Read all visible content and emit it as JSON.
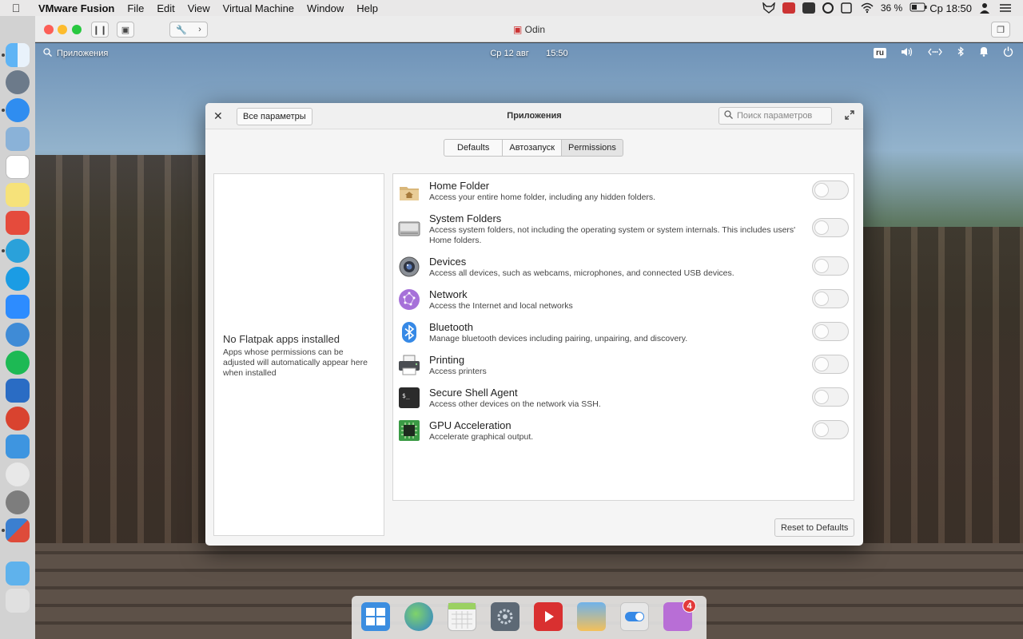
{
  "mac_menubar": {
    "app_name": "VMware Fusion",
    "menus": [
      "File",
      "Edit",
      "View",
      "Virtual Machine",
      "Window",
      "Help"
    ],
    "battery": "36 %",
    "clock": "Ср 18:50"
  },
  "vm_window": {
    "title": "Odin"
  },
  "panel": {
    "applications_label": "Приложения",
    "date": "Ср 12 авг",
    "time": "15:50",
    "keyboard_layout": "ru"
  },
  "settings": {
    "all_settings_label": "Все параметры",
    "title": "Приложения",
    "search_placeholder": "Поиск параметров",
    "tabs": [
      {
        "label": "Defaults",
        "active": false
      },
      {
        "label": "Автозапуск",
        "active": false
      },
      {
        "label": "Permissions",
        "active": true
      }
    ],
    "empty": {
      "title": "No Flatpak apps installed",
      "description": "Apps whose permissions can be adjusted will automatically appear here when installed"
    },
    "permissions": [
      {
        "title": "Home Folder",
        "description": "Access your entire home folder, including any hidden folders.",
        "icon": "home-folder-icon",
        "enabled": false
      },
      {
        "title": "System Folders",
        "description": "Access system folders, not including the operating system or system internals. This includes users' Home folders.",
        "icon": "drive-icon",
        "enabled": false
      },
      {
        "title": "Devices",
        "description": "Access all devices, such as webcams, microphones, and connected USB devices.",
        "icon": "webcam-icon",
        "enabled": false
      },
      {
        "title": "Network",
        "description": "Access the Internet and local networks",
        "icon": "network-icon",
        "enabled": false
      },
      {
        "title": "Bluetooth",
        "description": "Manage bluetooth devices including pairing, unpairing, and discovery.",
        "icon": "bluetooth-icon",
        "enabled": false
      },
      {
        "title": "Printing",
        "description": "Access printers",
        "icon": "printer-icon",
        "enabled": false
      },
      {
        "title": "Secure Shell Agent",
        "description": "Access other devices on the network via SSH.",
        "icon": "terminal-icon",
        "enabled": false
      },
      {
        "title": "GPU Acceleration",
        "description": "Accelerate graphical output.",
        "icon": "gpu-chip-icon",
        "enabled": false
      }
    ],
    "reset_label": "Reset to Defaults"
  },
  "guest_dock": {
    "badge_count": "4"
  },
  "colors": {
    "accent_blue": "#3689e6",
    "badge_red": "#e23a3a"
  }
}
